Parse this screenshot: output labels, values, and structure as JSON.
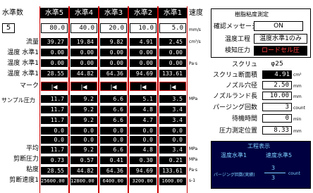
{
  "header": {
    "water_count_label": "水準数",
    "water_count_value": "5",
    "speed_label": "速度",
    "columns": [
      "水準5",
      "水準4",
      "水準3",
      "水準2",
      "水準1"
    ],
    "speeds": [
      "80.0",
      "40.0",
      "20.0",
      "10.0",
      "5.0"
    ],
    "speed_unit": "mm/s"
  },
  "rows": {
    "flow": {
      "label": "流量",
      "unit": "cm³/s",
      "values": [
        "39.27",
        "19.84",
        "9.82",
        "4.91",
        "2.45"
      ]
    },
    "temp1": {
      "label": "温度 水準1",
      "values": [
        "0.00",
        "0.00",
        "0.00",
        "0.00",
        "0.00"
      ]
    },
    "temp2": {
      "label": "温度 水準1",
      "unit": "Pa·s",
      "values": [
        "0.00",
        "0.00",
        "0.00",
        "0.00",
        "0.00"
      ]
    },
    "temp3": {
      "label": "温度 水準1",
      "values": [
        "28.55",
        "44.82",
        "64.36",
        "94.69",
        "133.61"
      ]
    },
    "marker": {
      "label": "マーク",
      "values": [
        "|◀",
        "|◀",
        "|◀",
        "|◀",
        "|◀"
      ]
    },
    "sample": {
      "label": "サンプル圧力",
      "unit": "MPa",
      "values": [
        "11.7",
        "9.2",
        "6.6",
        "5.1",
        "3.5"
      ]
    },
    "sample2": {
      "values": [
        "11.7",
        "9.2",
        "6.6",
        "4.8",
        "3.4"
      ]
    },
    "sample3": {
      "values": [
        "11.7",
        "9.2",
        "6.6",
        "4.7",
        "3.4"
      ]
    },
    "sample4": {
      "values": [
        "0.0",
        "0.0",
        "0.0",
        "0.0",
        "0.0"
      ]
    },
    "sample5": {
      "values": [
        "0.0",
        "0.0",
        "0.0",
        "0.0",
        "0.0"
      ]
    },
    "avg": {
      "label": "平均",
      "unit": "MPa",
      "values": [
        "11.7",
        "9.2",
        "6.6",
        "4.8",
        "3.4"
      ]
    },
    "shear_p": {
      "label": "剪断圧力",
      "unit": "MPa",
      "values": [
        "0.73",
        "0.57",
        "0.41",
        "0.30",
        "0.21"
      ]
    },
    "visc": {
      "label": "粘度",
      "unit": "Pa·s",
      "values": [
        "28.55",
        "44.82",
        "64.36",
        "94.69",
        "133.61"
      ]
    },
    "shear_rate": {
      "label": "剪断速度1",
      "unit": "s-1",
      "values": [
        "25600.00",
        "12800.00",
        "6400.00",
        "3200.00",
        "1600.00"
      ]
    }
  },
  "measure": {
    "title": "樹脂粘度測定",
    "confirm_label": "確認メッセージ",
    "confirm_value": "ON",
    "temp_proc_label": "温度工程",
    "temp_proc_value": "温度水準1のみ",
    "detect_label": "検知圧力",
    "detect_value": "ロードセル圧"
  },
  "params": {
    "screw_label": "スクリュ",
    "screw_value": "φ25",
    "area_label": "スクリュ断面積",
    "area_value": "4.91",
    "area_unit": "cm²",
    "nozzle_d_label": "ノズル穴径",
    "nozzle_d_value": "2.50",
    "nozzle_d_unit": "mm",
    "nozzle_l_label": "ノズルランド長",
    "nozzle_l_value": "10.00",
    "nozzle_l_unit": "mm",
    "purge_label": "パージング回数",
    "purge_value": "3",
    "purge_unit": "count",
    "wait_label": "待機時間",
    "wait_value": "0",
    "wait_unit": "min",
    "pos_label": "圧力測定位置",
    "pos_value": "8.33",
    "pos_unit": "mm"
  },
  "process": {
    "title": "工程表示",
    "left": "温度水準1",
    "right": "速度水準5",
    "purge_label": "パージング回数(実績)",
    "num": "3",
    "den": "3",
    "unit": "count"
  },
  "colors": {
    "accent_red": "#cc0000",
    "panel_navy": "#000040",
    "text_cyan": "#7fd4ff"
  }
}
